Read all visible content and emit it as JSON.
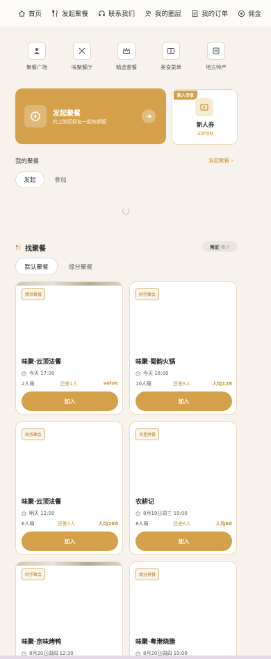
{
  "nav": {
    "items": [
      {
        "label": "首页",
        "icon": "home-icon"
      },
      {
        "label": "发起聚餐",
        "icon": "fork-knife-icon"
      },
      {
        "label": "联系我们",
        "icon": "headset-icon"
      },
      {
        "label": "我的圈层",
        "icon": "users-icon"
      },
      {
        "label": "我的订单",
        "icon": "document-icon"
      },
      {
        "label": "佣金",
        "icon": "coin-icon"
      }
    ]
  },
  "categories": [
    {
      "label": "聚餐广场",
      "icon": "people-icon"
    },
    {
      "label": "味聚餐厅",
      "icon": "utensils-icon"
    },
    {
      "label": "精选套餐",
      "icon": "crown-icon"
    },
    {
      "label": "美食菜单",
      "icon": "book-icon"
    },
    {
      "label": "地方特产",
      "icon": "list-icon"
    }
  ],
  "launch": {
    "title": "发起聚餐",
    "subtitle": "约上附近好友一起吃顿饭"
  },
  "coupon": {
    "tag": "新人专享",
    "title": "新人券",
    "subtitle": "立即领取"
  },
  "my_meals": {
    "title": "我的聚餐",
    "link": "发起聚餐 ›",
    "tabs": [
      "发起",
      "参加"
    ]
  },
  "find": {
    "title": "找聚餐",
    "toggle_active": "附近",
    "toggle_sep": "/",
    "toggle_inactive": "缘分",
    "tabs": [
      "默认聚餐",
      "缘分聚餐"
    ]
  },
  "cards": [
    {
      "badge": "情侣聚餐",
      "name": "味聚·云顶法餐",
      "time": "今天 17:00",
      "people": "2人局",
      "remain": "还差1人",
      "price": "value",
      "join": "加入"
    },
    {
      "badge": "同学聚会",
      "name": "味聚·蜀韵火锅",
      "time": "今天 18:00",
      "people": "10人局",
      "remain": "还差8人",
      "price": "人均128",
      "join": "加入"
    },
    {
      "badge": "商务聚会",
      "name": "味聚·云顶法餐",
      "time": "明天 12:00",
      "people": "6人局",
      "remain": "还差4人",
      "price": "人均268",
      "join": "加入"
    },
    {
      "badge": "邻里拼餐",
      "name": "农耕记",
      "time": "8月19日周三 19:00",
      "people": "8人局",
      "remain": "还差6人",
      "price": "人均68",
      "join": "加入"
    },
    {
      "badge": "同学聚会",
      "name": "味聚·京味烤鸭",
      "time": "8月20日周四 12:30",
      "people": "",
      "remain": "",
      "price": "",
      "join": ""
    },
    {
      "badge": "缘分拼餐",
      "name": "味聚·粤港烧腊",
      "time": "8月20日周四 19:00",
      "people": "",
      "remain": "",
      "price": "",
      "join": ""
    }
  ],
  "colors": {
    "accent": "#d4a04a",
    "background": "#f7f3ec"
  }
}
